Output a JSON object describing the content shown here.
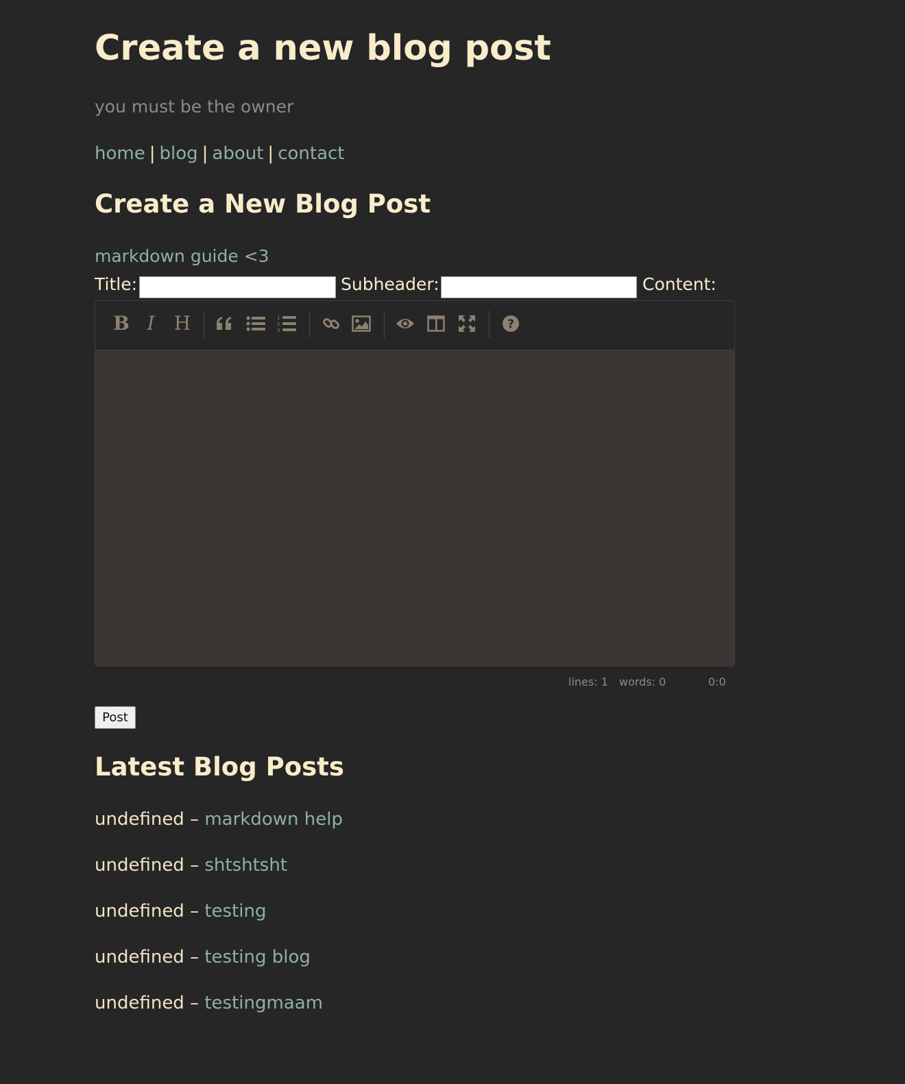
{
  "header": {
    "title": "Create a new blog post",
    "tagline": "you must be the owner"
  },
  "nav": {
    "items": [
      "home",
      "blog",
      "about",
      "contact"
    ],
    "separator": "|"
  },
  "form": {
    "heading": "Create a New Blog Post",
    "guide_link": "markdown guide <3",
    "title_label": "Title:",
    "title_value": "",
    "subheader_label": "Subheader:",
    "subheader_value": "",
    "content_label": "Content:",
    "toolbar": [
      {
        "name": "bold-icon",
        "label": "B"
      },
      {
        "name": "italic-icon",
        "label": "I"
      },
      {
        "name": "heading-icon",
        "label": "H"
      },
      {
        "name": "quote-icon"
      },
      {
        "name": "unordered-list-icon"
      },
      {
        "name": "ordered-list-icon"
      },
      {
        "name": "link-icon"
      },
      {
        "name": "image-icon"
      },
      {
        "name": "preview-eye-icon"
      },
      {
        "name": "side-by-side-icon"
      },
      {
        "name": "fullscreen-icon"
      },
      {
        "name": "help-question-icon"
      }
    ],
    "status": {
      "lines": "lines: 1",
      "words": "words: 0",
      "cursor": "0:0"
    },
    "submit_label": "Post"
  },
  "latest": {
    "heading": "Latest Blog Posts",
    "dash": "–",
    "posts": [
      {
        "date": "undefined",
        "title": "markdown help"
      },
      {
        "date": "undefined",
        "title": "shtshtsht"
      },
      {
        "date": "undefined",
        "title": "testing"
      },
      {
        "date": "undefined",
        "title": "testing blog"
      },
      {
        "date": "undefined",
        "title": "testingmaam"
      }
    ]
  },
  "colors": {
    "background": "#262626",
    "heading": "#f8eccb",
    "link": "#8fb0a6",
    "muted": "#8f8a84",
    "editor_bg": "#3b3633",
    "icon": "#8c8170"
  }
}
